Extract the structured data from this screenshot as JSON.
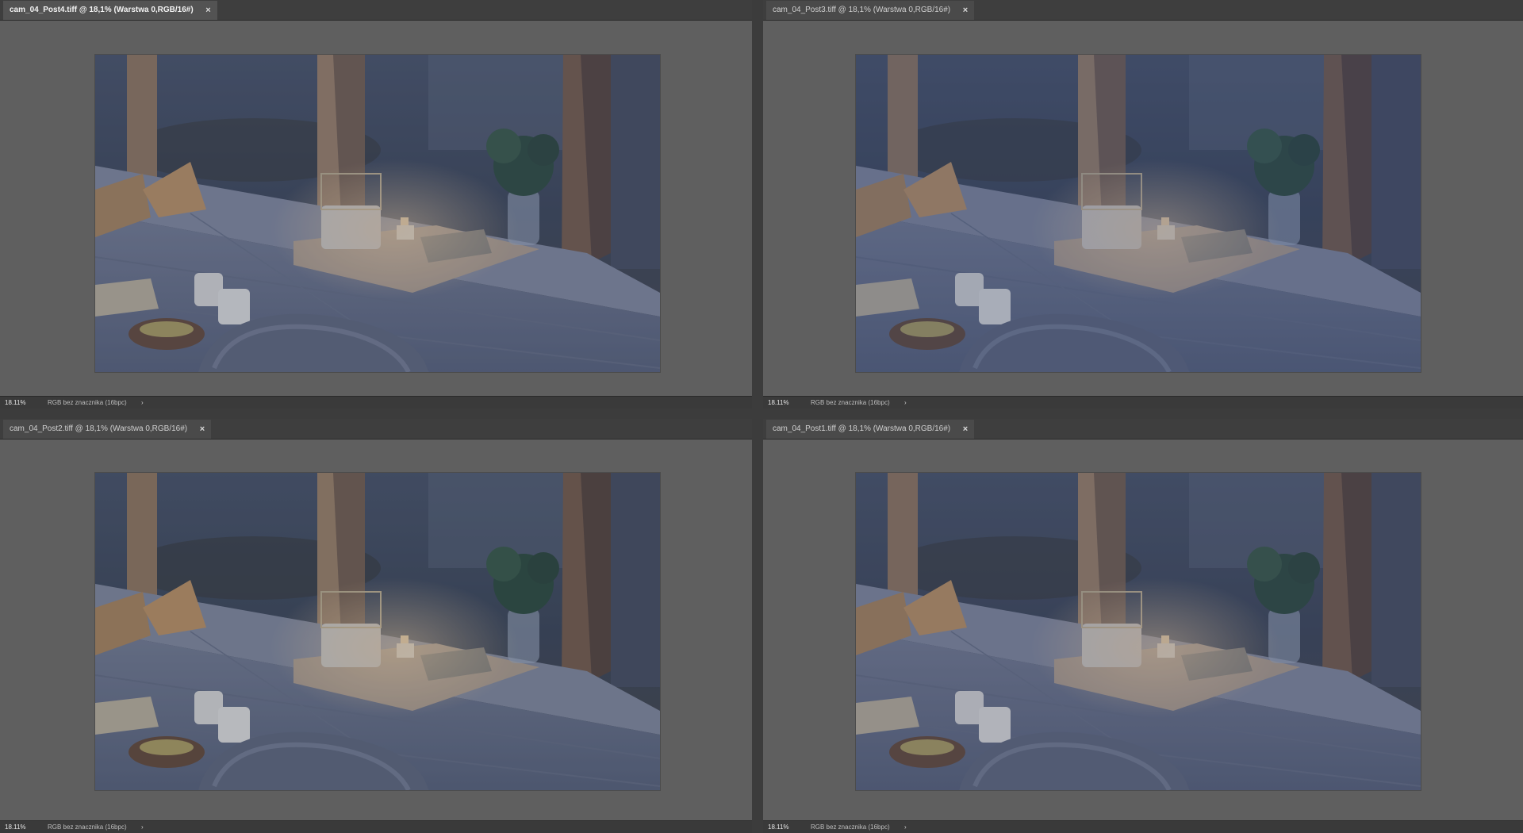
{
  "documents": [
    {
      "tab_title": "cam_04_Post4.tiff @ 18,1% (Warstwa 0,RGB/16#)",
      "close_glyph": "×",
      "zoom": "18.11%",
      "profile": "RGB bez znacznika (16bpc)",
      "more_glyph": "›",
      "active": true,
      "grade": {
        "overlay": "#2a3a66",
        "overlay_opacity": 0.3
      }
    },
    {
      "tab_title": "cam_04_Post3.tiff @ 18,1% (Warstwa 0,RGB/16#)",
      "close_glyph": "×",
      "zoom": "18.11%",
      "profile": "RGB bez znacznika (16bpc)",
      "more_glyph": "›",
      "active": false,
      "grade": {
        "overlay": "#2a3d70",
        "overlay_opacity": 0.36
      }
    },
    {
      "tab_title": "cam_04_Post2.tiff @ 18,1% (Warstwa 0,RGB/16#)",
      "close_glyph": "×",
      "zoom": "18.11%",
      "profile": "RGB bez znacznika (16bpc)",
      "more_glyph": "›",
      "active": false,
      "grade": {
        "overlay": "#24365e",
        "overlay_opacity": 0.28
      }
    },
    {
      "tab_title": "cam_04_Post1.tiff @ 18,1% (Warstwa 0,RGB/16#)",
      "close_glyph": "×",
      "zoom": "18.11%",
      "profile": "RGB bez znacznika (16bpc)",
      "more_glyph": "›",
      "active": false,
      "grade": {
        "overlay": "#2c3b66",
        "overlay_opacity": 0.32
      }
    }
  ],
  "colors": {
    "workspace_bg": "#3c3c3c",
    "canvas_bg": "#5f5f5f",
    "tab_bg": "#535353",
    "statusbar_bg": "#3a3a3a"
  }
}
